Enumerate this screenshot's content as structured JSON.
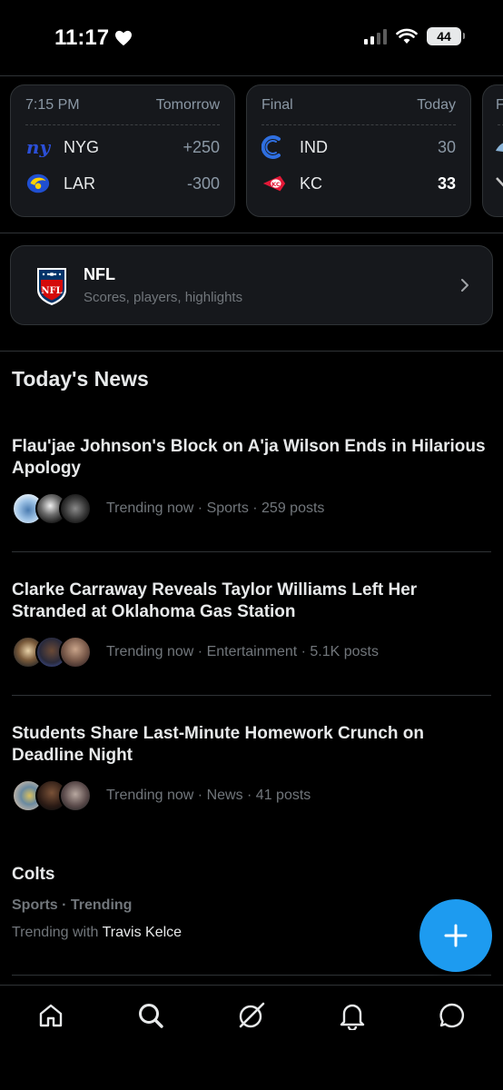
{
  "status_bar": {
    "time": "11:17",
    "battery": "44"
  },
  "scores": [
    {
      "status": "7:15 PM",
      "day": "Tomorrow",
      "teams": [
        {
          "abbr": "NYG",
          "value": "+250",
          "logo": "giants-logo"
        },
        {
          "abbr": "LAR",
          "value": "-300",
          "logo": "rams-logo"
        }
      ]
    },
    {
      "status": "Final",
      "day": "Today",
      "teams": [
        {
          "abbr": "IND",
          "value": "30",
          "logo": "colts-logo"
        },
        {
          "abbr": "KC",
          "value": "33",
          "logo": "chiefs-logo"
        }
      ]
    },
    {
      "status": "F"
    }
  ],
  "nfl_card": {
    "title": "NFL",
    "subtitle": "Scores, players, highlights",
    "icon": "nfl-shield-icon"
  },
  "news": {
    "section_title": "Today's News",
    "items": [
      {
        "headline": "Flau'jae Johnson's Block on A'ja Wilson Ends in Hilarious Apology",
        "meta": "Trending now · Sports · 259 posts"
      },
      {
        "headline": "Clarke Carraway Reveals Taylor Williams Left Her Stranded at Oklahoma Gas Station",
        "meta": "Trending now · Entertainment · 5.1K posts"
      },
      {
        "headline": "Students Share Last-Minute Homework Crunch on Deadline Night",
        "meta": "Trending now · News · 41 posts"
      }
    ]
  },
  "trending": {
    "title": "Colts",
    "category": "Sports · Trending",
    "with_prefix": "Trending with ",
    "with_name": "Travis Kelce"
  },
  "nav": [
    "home-icon",
    "search-icon",
    "grok-icon",
    "notifications-icon",
    "messages-icon"
  ],
  "colors": {
    "accent": "#1d9bf0",
    "background": "#000000",
    "card": "#16181c"
  }
}
